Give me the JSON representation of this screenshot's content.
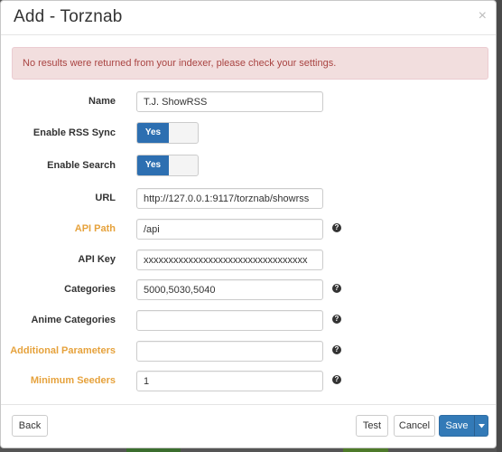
{
  "modal": {
    "title": "Add - Torznab",
    "close_glyph": "×"
  },
  "alert": {
    "message": "No results were returned from your indexer, please check your settings."
  },
  "fields": {
    "name": {
      "label": "Name",
      "value": "T.J. ShowRSS"
    },
    "enable_rss": {
      "label": "Enable RSS Sync",
      "state": "Yes"
    },
    "enable_search": {
      "label": "Enable Search",
      "state": "Yes"
    },
    "url": {
      "label": "URL",
      "value": "http://127.0.0.1:9117/torznab/showrss"
    },
    "api_path": {
      "label": "API Path",
      "value": "/api"
    },
    "api_key": {
      "label": "API Key",
      "value": "xxxxxxxxxxxxxxxxxxxxxxxxxxxxxxxxx"
    },
    "categories": {
      "label": "Categories",
      "value": "5000,5030,5040"
    },
    "anime_categories": {
      "label": "Anime Categories",
      "value": ""
    },
    "additional_parameters": {
      "label": "Additional Parameters",
      "value": ""
    },
    "minimum_seeders": {
      "label": "Minimum Seeders",
      "value": "1"
    }
  },
  "help_glyph": "?",
  "footer": {
    "back_label": "Back",
    "test_label": "Test",
    "cancel_label": "Cancel",
    "save_label": "Save"
  },
  "colors": {
    "accent": "#337ab7",
    "advanced_label": "#e6a23c",
    "alert_bg": "#f2dede",
    "alert_text": "#a94442"
  },
  "icons": [
    "close-icon",
    "question-circle-icon",
    "caret-down-icon"
  ]
}
